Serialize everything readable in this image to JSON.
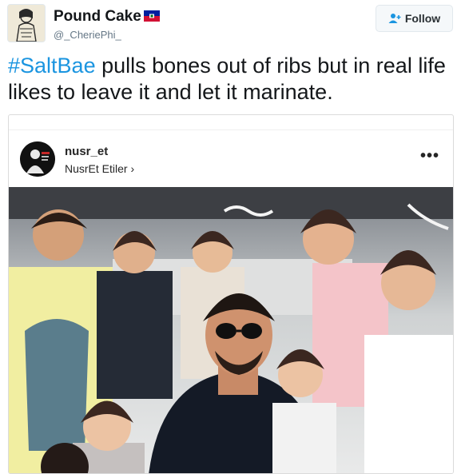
{
  "tweet": {
    "display_name": "Pound Cake",
    "handle": "@_CheriePhi_",
    "flag_icon": "haiti-flag-icon",
    "follow_label": "Follow",
    "follow_icon": "add-user-icon",
    "text_hashtag": "#SaltBae",
    "text_body": " pulls bones out of ribs but in real life likes to leave it and let it marinate."
  },
  "embed": {
    "username": "nusr_et",
    "location": "NusrEt Etiler",
    "location_chevron": "›",
    "more_icon": "•••"
  },
  "colors": {
    "link": "#1b95e0",
    "follow_bg": "#f5f8fa",
    "border": "#e1e8ed"
  }
}
